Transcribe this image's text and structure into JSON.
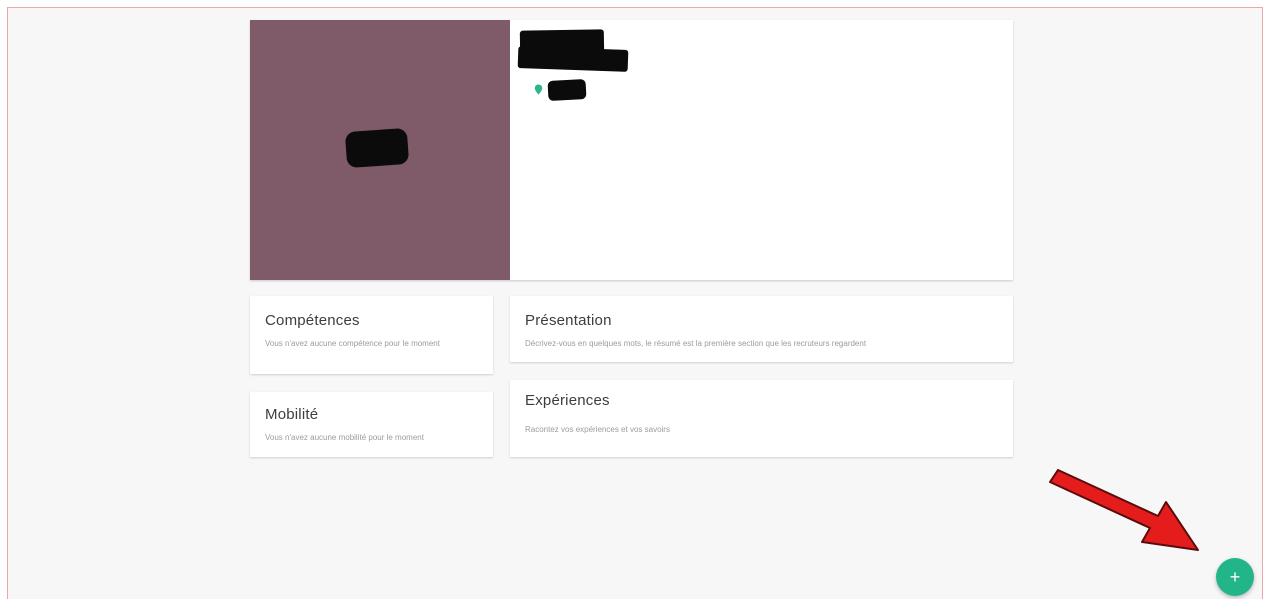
{
  "sections": {
    "competences": {
      "title": "Compétences",
      "description": "Vous n'avez aucune compétence pour le moment"
    },
    "mobilite": {
      "title": "Mobilité",
      "description": "Vous n'avez aucune mobilité pour le moment"
    },
    "presentation": {
      "title": "Présentation",
      "description": "Décrivez-vous en quelques mots, le résumé est la première section que les recruteurs regardent"
    },
    "experiences": {
      "title": "Expériences",
      "description": "Racontez vos expériences et vos savoirs"
    }
  },
  "fab": {
    "label": "+"
  },
  "colors": {
    "avatar_bg": "#7f5a68",
    "accent": "#22b58a",
    "annotation_arrow": "#e51c1c",
    "frame_border": "#e8a9a9"
  },
  "icons": {
    "location": "location-pin-icon",
    "fab": "plus-icon",
    "annotation": "red-arrow-annotation"
  }
}
